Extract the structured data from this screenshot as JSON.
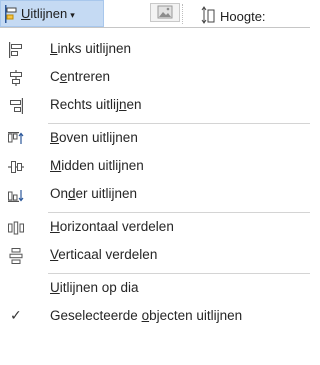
{
  "ribbon": {
    "align_button": {
      "label_pre": "",
      "label_key": "U",
      "label_post": "itlijnen",
      "caret": "▾",
      "icon": "align-left-icon"
    },
    "image_icon": "image-placeholder-icon",
    "height_icon": "height-icon",
    "height_label": "Hoogte:"
  },
  "menu": {
    "items": [
      {
        "pre": "",
        "key": "L",
        "post": "inks uitlijnen",
        "icon": "align-left-icon"
      },
      {
        "pre": "C",
        "key": "e",
        "post": "ntreren",
        "icon": "align-center-icon"
      },
      {
        "pre": "Rechts uitlij",
        "key": "n",
        "post": "en",
        "icon": "align-right-icon"
      },
      {
        "pre": "",
        "key": "B",
        "post": "oven uitlijnen",
        "icon": "align-top-icon"
      },
      {
        "pre": "",
        "key": "M",
        "post": "idden uitlijnen",
        "icon": "align-middle-icon"
      },
      {
        "pre": "On",
        "key": "d",
        "post": "er uitlijnen",
        "icon": "align-bottom-icon"
      },
      {
        "pre": "",
        "key": "H",
        "post": "orizontaal verdelen",
        "icon": "distribute-horizontal-icon"
      },
      {
        "pre": "",
        "key": "V",
        "post": "erticaal verdelen",
        "icon": "distribute-vertical-icon"
      },
      {
        "pre": "",
        "key": "U",
        "post": "itlijnen op dia",
        "icon": ""
      },
      {
        "pre": "Geselecteerde ",
        "key": "o",
        "post": "bjecten uitlijnen",
        "icon": "checkmark-icon",
        "check": "✓"
      }
    ]
  }
}
